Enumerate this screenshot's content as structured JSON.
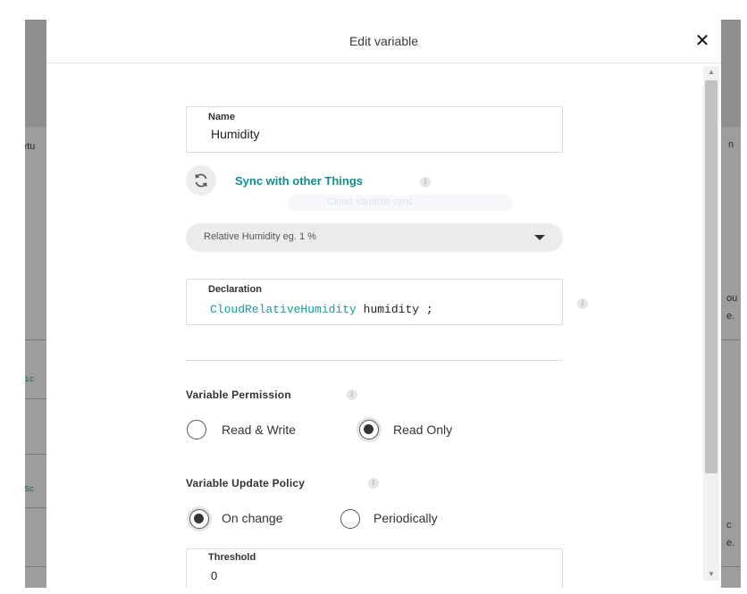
{
  "background": {
    "left_fragments": [
      "etu",
      "mic",
      "eSc"
    ],
    "right_fragments": [
      "n",
      "ou",
      "e.",
      "c",
      "e."
    ]
  },
  "dialog": {
    "title": "Edit variable",
    "close_glyph": "✕"
  },
  "name_field": {
    "label": "Name",
    "value": "Humidity"
  },
  "sync": {
    "label": "Sync with other Things",
    "icon": "sync-icon"
  },
  "ghost_pill_text": "Cloud variable sync",
  "type_select": {
    "selected": "Relative Humidity  eg. 1 %"
  },
  "declaration": {
    "label": "Declaration",
    "type": "CloudRelativeHumidity",
    "name": "humidity",
    "terminator": ";"
  },
  "permission": {
    "title": "Variable Permission",
    "options": [
      {
        "label": "Read & Write",
        "checked": false
      },
      {
        "label": "Read Only",
        "checked": true
      }
    ]
  },
  "update_policy": {
    "title": "Variable Update Policy",
    "options": [
      {
        "label": "On change",
        "checked": true
      },
      {
        "label": "Periodically",
        "checked": false
      }
    ]
  },
  "threshold": {
    "label": "Threshold",
    "value": "0"
  },
  "info_glyph": "i",
  "scrollbar": {
    "up_glyph": "▲",
    "down_glyph": "▼"
  },
  "colors": {
    "accent": "#128c8c",
    "code_type": "#1a9a9a",
    "overlay": "#9d9d9d"
  }
}
